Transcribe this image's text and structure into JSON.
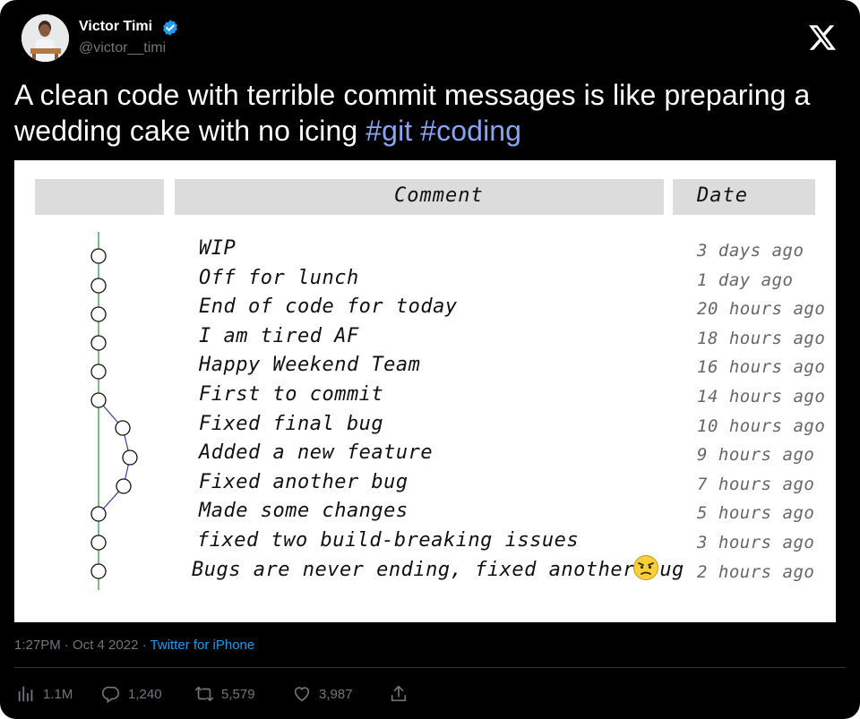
{
  "author": {
    "name": "Victor Timi",
    "handle": "@victor__timi",
    "verified": true
  },
  "tweet": {
    "text": "A clean code with terrible commit messages is like preparing a wedding cake with no icing",
    "hashtags": [
      "#git",
      "#coding"
    ]
  },
  "media": {
    "headers": {
      "comment": "Comment",
      "date": "Date"
    },
    "commits": [
      {
        "message": "WIP",
        "date": "3 days ago"
      },
      {
        "message": "Off for lunch",
        "date": "1 day ago"
      },
      {
        "message": "End of code for today",
        "date": "20 hours ago"
      },
      {
        "message": "I am tired AF",
        "date": "18 hours ago"
      },
      {
        "message": "Happy Weekend Team",
        "date": "16 hours ago"
      },
      {
        "message": "First to commit",
        "date": "14 hours ago"
      },
      {
        "message": "Fixed final bug",
        "date": "10 hours ago"
      },
      {
        "message": "Added a new feature",
        "date": "9 hours ago"
      },
      {
        "message": "Fixed another bug",
        "date": "7 hours ago"
      },
      {
        "message": "Made some changes",
        "date": "5 hours ago"
      },
      {
        "message": "fixed two build-breaking issues",
        "date": "3 hours ago"
      },
      {
        "message": "Bugs are never ending, fixed another bug",
        "date": "2 hours ago"
      }
    ],
    "emoji_icon": "angry-face-icon"
  },
  "meta": {
    "time": "1:27PM",
    "date": "Oct 4 2022",
    "separator": "·",
    "source": "Twitter for iPhone"
  },
  "actions": {
    "views": "1.1M",
    "replies": "1,240",
    "retweets": "5,579",
    "likes": "3,987"
  },
  "colors": {
    "background": "#000000",
    "hashtag": "#8aa4f0",
    "link": "#1d9bf0",
    "verified": "#1d9bf0",
    "muted": "#71767b"
  }
}
